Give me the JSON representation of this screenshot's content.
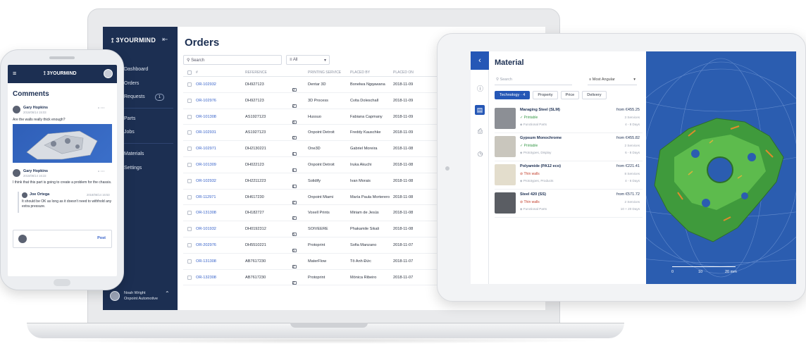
{
  "laptop": {
    "brand": "3YOURMIND",
    "collapse_icon": "⇤",
    "nav": [
      "Dashboard",
      "Orders",
      "Requests",
      "Parts",
      "Jobs",
      "Materials",
      "Settings"
    ],
    "requests_badge": "1",
    "user": {
      "name": "Noah Wright",
      "company": "Onpoint Automotive"
    },
    "page_title": "Orders",
    "search_placeholder": "Search",
    "filter_value": "All",
    "columns": {
      "id": "#",
      "reference": "REFERENCE",
      "service": "PRINTING SERVICE",
      "placed_by": "PLACED BY",
      "placed_on": "PLACED ON"
    },
    "rows": [
      {
        "id": "OR-102932",
        "reference": "DH927123",
        "messages": "0",
        "service": "Dentar 3D",
        "placed_by": "Bonelwa Ngqawana",
        "placed_on": "2018-11-09"
      },
      {
        "id": "OR-102976",
        "reference": "DH927123",
        "messages": "2",
        "service": "3D Process",
        "placed_by": "Cvita Doleschall",
        "placed_on": "2018-11-09"
      },
      {
        "id": "OR-101308",
        "reference": "AS1927123",
        "messages": "3",
        "service": "Hussuo",
        "placed_by": "Fabiana Capmany",
        "placed_on": "2018-11-09"
      },
      {
        "id": "OR-102931",
        "reference": "AS1927123",
        "messages": "0",
        "service": "Onpoint Detroit",
        "placed_by": "Freddy Kauschke",
        "placed_on": "2018-11-09"
      },
      {
        "id": "OR-102971",
        "reference": "DH2130221",
        "messages": "1",
        "service": "One3D",
        "placed_by": "Gabriel Moreira",
        "placed_on": "2018-11-08"
      },
      {
        "id": "OR-101309",
        "reference": "DH022123",
        "messages": "1",
        "service": "Onpoint Detroit",
        "placed_by": "Iruka Akuchi",
        "placed_on": "2018-11-08"
      },
      {
        "id": "OR-102932",
        "reference": "DH2211223",
        "messages": "1",
        "service": "Solidify",
        "placed_by": "Ivan Morais",
        "placed_on": "2018-11-08"
      },
      {
        "id": "OR-112971",
        "reference": "DH617230",
        "messages": "2",
        "service": "Onpoint Miami",
        "placed_by": "María Paula Morterero",
        "placed_on": "2018-11-08"
      },
      {
        "id": "OR-131308",
        "reference": "DH182727",
        "messages": "2",
        "service": "Voxell Prints",
        "placed_by": "Miriam de Jesús",
        "placed_on": "2018-11-08"
      },
      {
        "id": "OR-101932",
        "reference": "DH0192312",
        "messages": "5",
        "service": "SOIVEERE",
        "placed_by": "Phakamile Sikali",
        "placed_on": "2018-11-08"
      },
      {
        "id": "OR-202976",
        "reference": "DH5510221",
        "messages": "6",
        "service": "Protoprint",
        "placed_by": "Sofia Manzano",
        "placed_on": "2018-11-07"
      },
      {
        "id": "OR-131308",
        "reference": "AB7617230",
        "messages": "2",
        "service": "MaterFlow",
        "placed_by": "Tô Anh Đức",
        "placed_on": "2018-11-07"
      },
      {
        "id": "OR-132308",
        "reference": "AB7617230",
        "messages": "2",
        "service": "Protoprint",
        "placed_by": "Mónica Ribeiro",
        "placed_on": "2018-11-07"
      }
    ]
  },
  "tablet": {
    "title": "Material",
    "search_placeholder": "Search",
    "sort_value": "Most Angular",
    "tabs": [
      {
        "label": "Technology · 4",
        "active": true
      },
      {
        "label": "Property",
        "active": false
      },
      {
        "label": "Price",
        "active": false
      },
      {
        "label": "Delivery",
        "active": false
      }
    ],
    "materials": [
      {
        "name": "Maraging Steel (SLM)",
        "status": "Printable",
        "status_type": "ok",
        "tag": "Functional Parts",
        "price": "from €455.25",
        "sub1": "3 Services",
        "sub2": "4 - 8 Days",
        "thumb": "#8c8f95"
      },
      {
        "name": "Gypsum Monochrome",
        "status": "Printable",
        "status_type": "ok",
        "tag": "Prototypes, Display",
        "price": "from €455.82",
        "sub1": "2 Services",
        "sub2": "6 - 8 Days",
        "thumb": "#c9c6bd"
      },
      {
        "name": "Polyamide (PA12 eco)",
        "status": "Thin walls",
        "status_type": "warn",
        "tag": "Prototypes, Products",
        "price": "from €221.41",
        "sub1": "8 Services",
        "sub2": "4 - 6 Days",
        "thumb": "#e3ddcc"
      },
      {
        "name": "Steel 420 (SS)",
        "status": "Thin walls",
        "status_type": "warn",
        "tag": "Functional Parts",
        "price": "from €571.72",
        "sub1": "2 Services",
        "sub2": "10 + 20 Days",
        "thumb": "#5a5d63"
      }
    ],
    "scale": {
      "start": "0",
      "mid": "10",
      "end": "20 mm"
    }
  },
  "phone": {
    "brand": "3YOURMIND",
    "title": "Comments",
    "comments": [
      {
        "author": "Gary Hopkins",
        "date": "2018/06/14 15:03",
        "text": "Are the walls really thick enough?"
      },
      {
        "author": "Gary Hopkins",
        "date": "2018/06/14 16:22",
        "text": "I think that this part is going to create a problem for the chassis."
      }
    ],
    "reply": {
      "author": "Joe Ortega",
      "date": "2018/06/14 16:53",
      "text": "It should be OK as long as it doesn't need to withhold any extra pressure."
    },
    "post_label": "Post"
  },
  "colors": {
    "navy": "#1c2f52",
    "brand_blue": "#2557b6",
    "link_blue": "#3561c9",
    "ok": "#3a9a4a",
    "warn": "#c3412f"
  }
}
